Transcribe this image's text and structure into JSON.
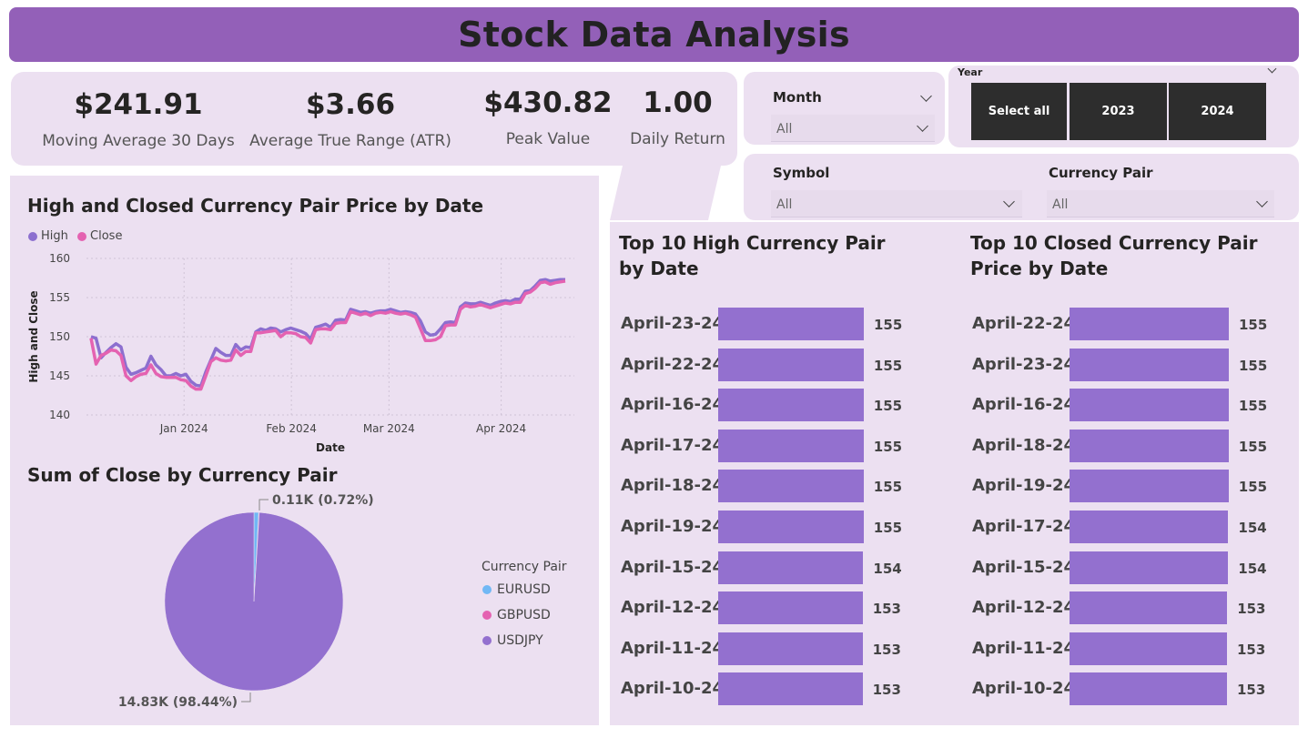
{
  "header": {
    "title": "Stock Data Analysis"
  },
  "kpis": [
    {
      "value": "$241.91",
      "label": "Moving Average 30 Days"
    },
    {
      "value": "$3.66",
      "label": "Average True Range (ATR)"
    },
    {
      "value": "$430.82",
      "label": "Peak Value"
    },
    {
      "value": "1.00",
      "label": "Daily Return"
    }
  ],
  "filters": {
    "month": {
      "label": "Month",
      "value": "All"
    },
    "year": {
      "label": "Year",
      "options": [
        "Select all",
        "2023",
        "2024"
      ]
    },
    "symbol": {
      "label": "Symbol",
      "value": "All"
    },
    "currency_pair": {
      "label": "Currency Pair",
      "value": "All"
    }
  },
  "colors": {
    "accent": "#9360b8",
    "panel": "#ece0f1",
    "high": "#8c6fcf",
    "close": "#e462b1",
    "bar": "#9370cf",
    "eurusd": "#71b8f5",
    "gbpusd": "#e462b1",
    "usdjpy": "#9370cf"
  },
  "chart_data": [
    {
      "type": "line",
      "title": "High and Closed Currency Pair Price by Date",
      "xlabel": "Date",
      "ylabel": "High and Close",
      "yticks": [
        "140",
        "145",
        "150",
        "155",
        "160"
      ],
      "xticks": [
        "Jan 2024",
        "Feb 2024",
        "Mar 2024",
        "Apr 2024"
      ],
      "ylim": [
        140,
        160
      ],
      "legend_position": "top-left",
      "grid": true,
      "series": [
        {
          "name": "High",
          "values": [
            150.0,
            149.8,
            147.3,
            148.0,
            148.6,
            149.1,
            148.7,
            146.1,
            145.2,
            145.4,
            145.7,
            146.0,
            147.5,
            146.4,
            145.8,
            145.0,
            145.0,
            145.3,
            145.0,
            145.2,
            144.3,
            143.8,
            143.7,
            145.5,
            147.0,
            148.5,
            148.0,
            147.6,
            147.6,
            149.0,
            148.3,
            148.7,
            148.6,
            150.6,
            151.0,
            150.8,
            151.1,
            151.0,
            150.6,
            150.9,
            151.1,
            150.9,
            150.7,
            150.4,
            149.7,
            151.2,
            151.4,
            151.6,
            151.2,
            152.1,
            152.2,
            152.1,
            153.5,
            153.3,
            153.1,
            153.2,
            153.0,
            153.2,
            153.3,
            153.3,
            153.5,
            153.3,
            153.1,
            153.2,
            153.1,
            152.9,
            152.0,
            150.6,
            150.2,
            150.3,
            151.0,
            151.8,
            151.9,
            151.8,
            153.8,
            154.3,
            154.2,
            154.2,
            154.4,
            154.2,
            154.0,
            154.3,
            154.5,
            154.6,
            154.5,
            154.8,
            154.8,
            155.8,
            155.9,
            156.5,
            157.2,
            157.3,
            157.1,
            157.2,
            157.3,
            157.3
          ]
        },
        {
          "name": "Close",
          "values": [
            149.8,
            146.5,
            147.6,
            147.9,
            148.3,
            148.2,
            147.6,
            145.0,
            144.4,
            144.9,
            145.2,
            145.3,
            146.4,
            145.3,
            144.9,
            144.8,
            144.8,
            144.8,
            144.5,
            144.4,
            143.7,
            143.3,
            143.3,
            145.0,
            146.8,
            147.3,
            147.0,
            146.9,
            147.0,
            148.3,
            147.6,
            148.1,
            148.1,
            150.5,
            150.5,
            150.6,
            150.7,
            150.8,
            150.0,
            150.5,
            150.5,
            150.4,
            150.0,
            149.9,
            149.2,
            150.9,
            151.0,
            151.0,
            150.9,
            151.7,
            151.8,
            151.8,
            153.2,
            153.0,
            152.8,
            153.0,
            152.7,
            153.0,
            153.1,
            153.0,
            153.2,
            153.0,
            152.9,
            153.0,
            152.8,
            152.5,
            151.0,
            149.5,
            149.5,
            149.6,
            150.0,
            151.4,
            151.5,
            151.5,
            153.5,
            154.0,
            153.8,
            153.9,
            154.1,
            153.9,
            153.7,
            153.9,
            154.1,
            154.3,
            154.2,
            154.4,
            154.4,
            155.5,
            155.7,
            156.2,
            156.9,
            157.0,
            156.7,
            156.9,
            157.0,
            157.1
          ]
        }
      ]
    },
    {
      "type": "pie",
      "title": "Sum of Close by Currency Pair",
      "legend_title": "Currency Pair",
      "legend_position": "right",
      "categories": [
        "EURUSD",
        "GBPUSD",
        "USDJPY"
      ],
      "values": [
        0.84,
        0.11,
        98.44
      ],
      "labels": [
        {
          "text": "0.11K (0.72%)"
        },
        {
          "text": "14.83K (98.44%)"
        }
      ]
    },
    {
      "type": "bar",
      "title": "Top 10 High Currency Pair by Date",
      "categories": [
        "April-23-24",
        "April-22-24",
        "April-16-24",
        "April-17-24",
        "April-18-24",
        "April-19-24",
        "April-15-24",
        "April-12-24",
        "April-11-24",
        "April-10-24"
      ],
      "values": [
        155.2,
        155.1,
        155.0,
        155.0,
        155.0,
        155.0,
        154.6,
        153.9,
        153.8,
        153.8
      ],
      "value_labels": [
        "155",
        "155",
        "155",
        "155",
        "155",
        "155",
        "154",
        "153",
        "153",
        "153"
      ],
      "xlim": [
        0,
        155.2
      ]
    },
    {
      "type": "bar",
      "title": "Top 10 Closed Currency Pair Price by Date",
      "categories": [
        "April-22-24",
        "April-23-24",
        "April-16-24",
        "April-18-24",
        "April-19-24",
        "April-17-24",
        "April-15-24",
        "April-12-24",
        "April-11-24",
        "April-10-24"
      ],
      "values": [
        154.8,
        154.8,
        154.7,
        154.6,
        154.6,
        154.3,
        154.2,
        153.2,
        153.0,
        153.0
      ],
      "value_labels": [
        "155",
        "155",
        "155",
        "155",
        "155",
        "154",
        "154",
        "153",
        "153",
        "153"
      ],
      "xlim": [
        0,
        154.8
      ]
    }
  ]
}
